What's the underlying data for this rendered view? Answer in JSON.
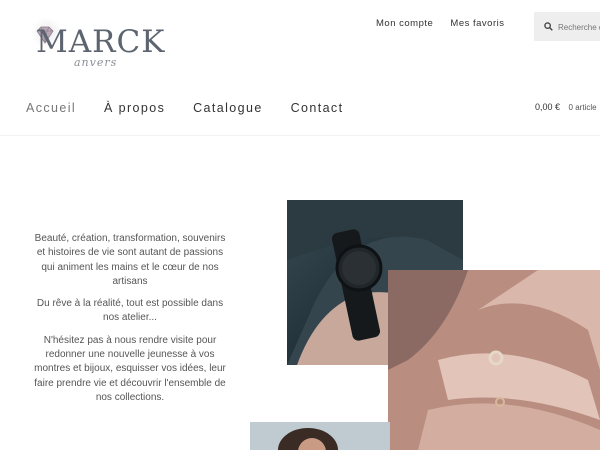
{
  "brand": {
    "logo_text": "MARCK",
    "logo_script": "anvers"
  },
  "top_links": [
    "Mon compte",
    "Mes favoris"
  ],
  "search": {
    "placeholder": "Recherche d"
  },
  "nav": [
    "Accueil",
    "À propos",
    "Catalogue",
    "Contact"
  ],
  "cart": {
    "price": "0,00 €",
    "count": "0 article"
  },
  "intro": [
    "Beauté, création, transformation, souvenirs et histoires de vie sont autant de passions qui animent les mains et le cœur de nos artisans",
    "Du rêve à la réalité, tout est possible dans nos atelier...",
    "N'hésitez pas à nous rendre visite pour redonner une nouvelle jeunesse à vos montres et bijoux, esquisser vos idées, leur faire prendre vie et découvrir l'ensemble de nos collections."
  ],
  "colors": {
    "accent": "#5c6470",
    "text": "#555555",
    "search_bg": "#eeeeee"
  }
}
